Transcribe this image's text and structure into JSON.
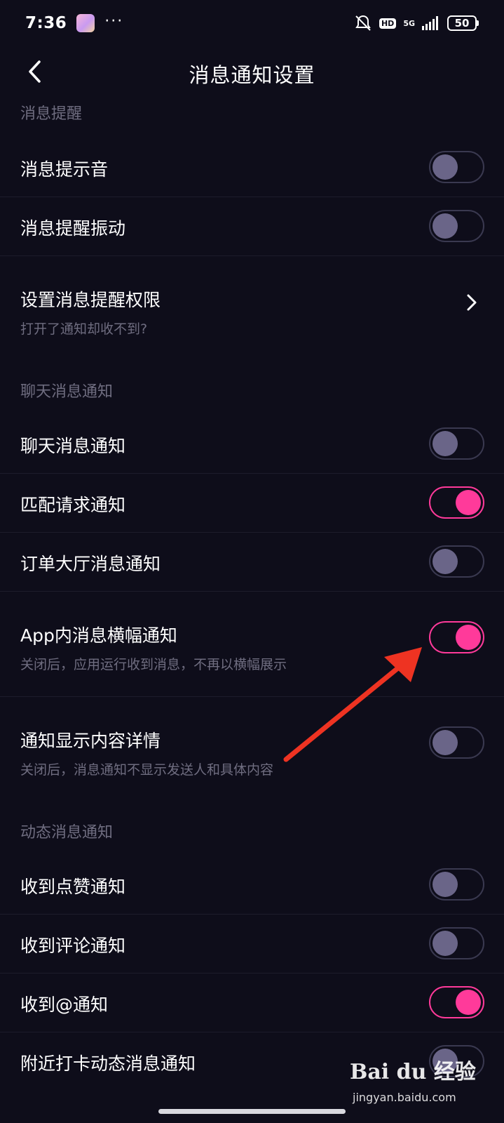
{
  "status_bar": {
    "time": "7:36",
    "more": "···",
    "hd": "HD",
    "network": "5G",
    "battery": "50"
  },
  "header": {
    "title": "消息通知设置"
  },
  "sections": {
    "reminder": "消息提醒",
    "chat": "聊天消息通知",
    "moments": "动态消息通知"
  },
  "rows": {
    "sound": {
      "label": "消息提示音",
      "enabled": false
    },
    "vibrate": {
      "label": "消息提醒振动",
      "enabled": false
    },
    "permission": {
      "label": "设置消息提醒权限",
      "sub": "打开了通知却收不到?"
    },
    "chat_notify": {
      "label": "聊天消息通知",
      "enabled": false
    },
    "match_request": {
      "label": "匹配请求通知",
      "enabled": true
    },
    "order_hall": {
      "label": "订单大厅消息通知",
      "enabled": false
    },
    "in_app_banner": {
      "label": "App内消息横幅通知",
      "sub": "关闭后，应用运行收到消息，不再以横幅展示",
      "enabled": true
    },
    "show_details": {
      "label": "通知显示内容详情",
      "sub": "关闭后，消息通知不显示发送人和具体内容",
      "enabled": false
    },
    "likes": {
      "label": "收到点赞通知",
      "enabled": false
    },
    "comments": {
      "label": "收到评论通知",
      "enabled": false
    },
    "mentions": {
      "label": "收到@通知",
      "enabled": true
    },
    "nearby_checkin": {
      "label": "附近打卡动态消息通知",
      "enabled": false
    }
  },
  "colors": {
    "background": "#0e0d1a",
    "toggle_on": "#ff3a9a",
    "toggle_off_knob": "#6a6588",
    "annotation_arrow": "#ee3322"
  },
  "watermark": {
    "logo": "Bai du 经验",
    "url": "jingyan.baidu.com"
  }
}
